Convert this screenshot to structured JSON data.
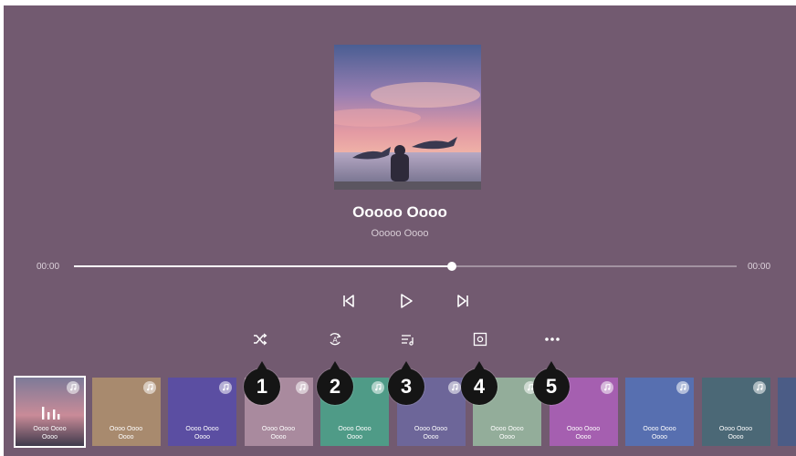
{
  "now_playing": {
    "title": "Ooooo Oooo",
    "artist": "Ooooo Oooo",
    "current_time": "00:00",
    "duration": "00:00",
    "progress": 0.57
  },
  "controls": [
    {
      "name": "previous-button",
      "icon": "skip-previous-icon"
    },
    {
      "name": "play-button",
      "icon": "play-icon"
    },
    {
      "name": "next-button",
      "icon": "skip-next-icon"
    }
  ],
  "options": [
    {
      "name": "shuffle-button",
      "icon": "shuffle-icon",
      "callout": "1"
    },
    {
      "name": "repeat-button",
      "icon": "repeat-a-icon",
      "callout": "2"
    },
    {
      "name": "playlist-button",
      "icon": "playlist-icon",
      "callout": "3"
    },
    {
      "name": "screen-off-button",
      "icon": "screen-icon",
      "callout": "4"
    },
    {
      "name": "more-button",
      "icon": "more-icon",
      "callout": "5"
    }
  ],
  "queue": [
    {
      "line1": "Oooo Oooo",
      "line2": "Oooo",
      "color": "#5a4f5f",
      "selected": true
    },
    {
      "line1": "Oooo Oooo",
      "line2": "Oooo",
      "color": "#a88a6e"
    },
    {
      "line1": "Oooo Oooo",
      "line2": "Oooo",
      "color": "#5b4ea2"
    },
    {
      "line1": "Oooo Oooo",
      "line2": "Oooo",
      "color": "#a98a9e"
    },
    {
      "line1": "Oooo Oooo",
      "line2": "Oooo",
      "color": "#4f9b87"
    },
    {
      "line1": "Oooo Oooo",
      "line2": "Oooo",
      "color": "#6d6699"
    },
    {
      "line1": "Oooo Oooo",
      "line2": "Oooo",
      "color": "#93ad9a"
    },
    {
      "line1": "Oooo Oooo",
      "line2": "Oooo",
      "color": "#a55fb0"
    },
    {
      "line1": "Oooo Oooo",
      "line2": "Oooo",
      "color": "#576fb0"
    },
    {
      "line1": "Oooo Oooo",
      "line2": "Oooo",
      "color": "#4b6876"
    },
    {
      "line1": "",
      "line2": "",
      "color": "#4b5c86"
    }
  ]
}
